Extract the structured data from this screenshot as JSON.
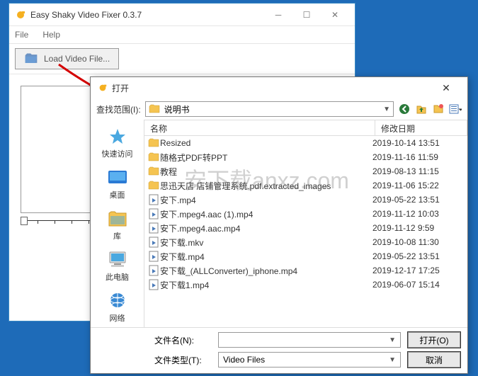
{
  "app": {
    "title": "Easy Shaky Video Fixer 0.3.7",
    "menu": {
      "file": "File",
      "help": "Help"
    },
    "load_btn": "Load Video File..."
  },
  "dialog": {
    "title": "打开",
    "lookup_label": "查找范围(I):",
    "lookup_value": "说明书",
    "places": [
      {
        "label": "快速访问",
        "icon": "star"
      },
      {
        "label": "桌面",
        "icon": "desktop"
      },
      {
        "label": "库",
        "icon": "library"
      },
      {
        "label": "此电脑",
        "icon": "pc"
      },
      {
        "label": "网络",
        "icon": "network"
      }
    ],
    "columns": {
      "name": "名称",
      "date": "修改日期"
    },
    "files": [
      {
        "type": "folder",
        "name": "Resized",
        "date": "2019-10-14 13:51"
      },
      {
        "type": "folder",
        "name": "随格式PDF转PPT",
        "date": "2019-11-16 11:59"
      },
      {
        "type": "folder",
        "name": "教程",
        "date": "2019-08-13 11:15"
      },
      {
        "type": "folder",
        "name": "思迅天店 店铺管理系统.pdf.extracted_images",
        "date": "2019-11-06 15:22"
      },
      {
        "type": "video",
        "name": "安下.mp4",
        "date": "2019-05-22 13:51"
      },
      {
        "type": "video",
        "name": "安下.mpeg4.aac (1).mp4",
        "date": "2019-11-12 10:03"
      },
      {
        "type": "video",
        "name": "安下.mpeg4.aac.mp4",
        "date": "2019-11-12 9:59"
      },
      {
        "type": "video",
        "name": "安下载.mkv",
        "date": "2019-10-08 11:30"
      },
      {
        "type": "video",
        "name": "安下载.mp4",
        "date": "2019-05-22 13:51"
      },
      {
        "type": "video",
        "name": "安下载_(ALLConverter)_iphone.mp4",
        "date": "2019-12-17 17:25"
      },
      {
        "type": "video",
        "name": "安下载1.mp4",
        "date": "2019-06-07 15:14"
      }
    ],
    "filename_label": "文件名(N):",
    "filename_value": "",
    "filetype_label": "文件类型(T):",
    "filetype_value": "Video Files",
    "open_btn": "打开(O)",
    "cancel_btn": "取消"
  },
  "watermark": {
    "main": "anxz",
    "suffix": ".com",
    "cn": "安下载"
  }
}
